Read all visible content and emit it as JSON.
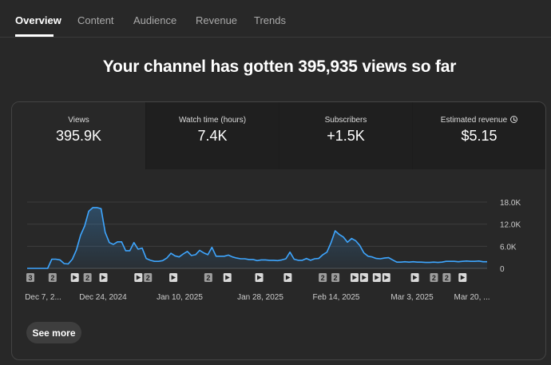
{
  "tabs": [
    {
      "label": "Overview",
      "active": true
    },
    {
      "label": "Content",
      "active": false
    },
    {
      "label": "Audience",
      "active": false
    },
    {
      "label": "Revenue",
      "active": false
    },
    {
      "label": "Trends",
      "active": false
    }
  ],
  "headline": "Your channel has gotten 395,935 views so far",
  "metrics": [
    {
      "label": "Views",
      "value": "395.9K",
      "selected": true
    },
    {
      "label": "Watch time (hours)",
      "value": "7.4K",
      "selected": false
    },
    {
      "label": "Subscribers",
      "value": "+1.5K",
      "selected": false
    },
    {
      "label": "Estimated revenue",
      "value": "$5.15",
      "selected": false,
      "icon": "clock-icon"
    }
  ],
  "colors": {
    "line": "#3ea6ff",
    "background": "#282828",
    "grid": "#3d3d3d"
  },
  "chart_data": {
    "type": "area",
    "series": [
      {
        "values": [
          0,
          0,
          0,
          0,
          0,
          0,
          2500,
          2500,
          2300,
          1300,
          1200,
          2500,
          5000,
          9000,
          11500,
          15500,
          16500,
          16500,
          16200,
          9800,
          7000,
          6500,
          7200,
          7200,
          4800,
          4800,
          7000,
          5200,
          5500,
          2700,
          2200,
          1900,
          1900,
          2100,
          2800,
          4100,
          3400,
          3100,
          3900,
          4600,
          3500,
          3700,
          4900,
          4200,
          3700,
          5700,
          3300,
          3300,
          3300,
          3600,
          3100,
          2800,
          2600,
          2600,
          2400,
          2400,
          2100,
          2300,
          2300,
          2200,
          2200,
          2100,
          2300,
          2600,
          4400,
          2500,
          2200,
          2200,
          2700,
          2200,
          2600,
          2700,
          3700,
          4400,
          7000,
          10200,
          9200,
          8500,
          7100,
          8100,
          7500,
          6200,
          4200,
          3300,
          3100,
          2700,
          2600,
          2800,
          2900,
          2300,
          1700,
          1700,
          1800,
          1700,
          1800,
          1700,
          1700,
          1600,
          1600,
          1700,
          1600,
          1700,
          1900,
          1900,
          1900,
          1800,
          1900,
          2000,
          1900,
          1900,
          2000,
          1800,
          1800
        ]
      }
    ],
    "x_labels": [
      "Dec 7, 2...",
      "Dec 24, 2024",
      "Jan 10, 2025",
      "Jan 28, 2025",
      "Feb 14, 2025",
      "Mar 3, 2025",
      "Mar 20, ..."
    ],
    "y_ticks": [
      "18.0K",
      "12.0K",
      "6.0K",
      "0"
    ],
    "y_tick_values": [
      18000,
      12000,
      6000,
      0
    ],
    "ylim": [
      0,
      18000
    ],
    "grid": true,
    "annotations": [
      {
        "index": 1,
        "label": "3",
        "kind": "count"
      },
      {
        "index": 8,
        "label": "2",
        "kind": "count"
      },
      {
        "index": 15,
        "label": "",
        "kind": "play"
      },
      {
        "index": 19,
        "label": "2",
        "kind": "count"
      },
      {
        "index": 24,
        "label": "",
        "kind": "play"
      },
      {
        "index": 35,
        "label": "",
        "kind": "play"
      },
      {
        "index": 38,
        "label": "2",
        "kind": "count"
      },
      {
        "index": 46,
        "label": "",
        "kind": "play"
      },
      {
        "index": 57,
        "label": "2",
        "kind": "count"
      },
      {
        "index": 63,
        "label": "",
        "kind": "play"
      },
      {
        "index": 73,
        "label": "",
        "kind": "play"
      },
      {
        "index": 82,
        "label": "",
        "kind": "play"
      },
      {
        "index": 93,
        "label": "2",
        "kind": "count"
      },
      {
        "index": 97,
        "label": "2",
        "kind": "count"
      },
      {
        "index": 103,
        "label": "",
        "kind": "play"
      },
      {
        "index": 106,
        "label": "",
        "kind": "play"
      },
      {
        "index": 110,
        "label": "",
        "kind": "play"
      },
      {
        "index": 113,
        "label": "",
        "kind": "play"
      },
      {
        "index": 122,
        "label": "",
        "kind": "play"
      },
      {
        "index": 128,
        "label": "2",
        "kind": "count"
      },
      {
        "index": 132,
        "label": "2",
        "kind": "count"
      },
      {
        "index": 137,
        "label": "",
        "kind": "play"
      }
    ]
  },
  "see_more": "See more"
}
